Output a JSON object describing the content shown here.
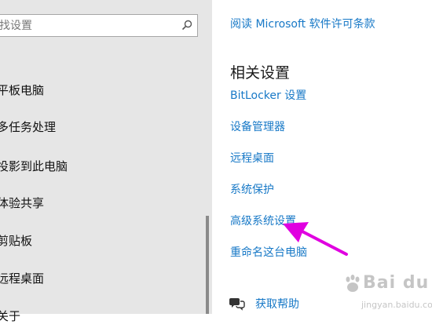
{
  "search": {
    "placeholder": "找设置"
  },
  "sidebar": {
    "items": [
      {
        "label": "平板电脑"
      },
      {
        "label": "多任务处理"
      },
      {
        "label": "投影到此电脑"
      },
      {
        "label": "体验共享"
      },
      {
        "label": "剪贴板"
      },
      {
        "label": "远程桌面"
      },
      {
        "label": "关于"
      }
    ]
  },
  "main": {
    "license_link": "阅读 Microsoft 软件许可条款",
    "related_title": "相关设置",
    "related_links": [
      {
        "label": "BitLocker 设置"
      },
      {
        "label": "设备管理器"
      },
      {
        "label": "远程桌面"
      },
      {
        "label": "系统保护"
      },
      {
        "label": "高级系统设置"
      },
      {
        "label": "重命名这台电脑"
      }
    ],
    "help_link": "获取帮助"
  },
  "annotation": {
    "arrow_color": "#e000e0"
  },
  "watermark": {
    "brand": "Bai du",
    "url": "jingyan.baidu.com"
  }
}
